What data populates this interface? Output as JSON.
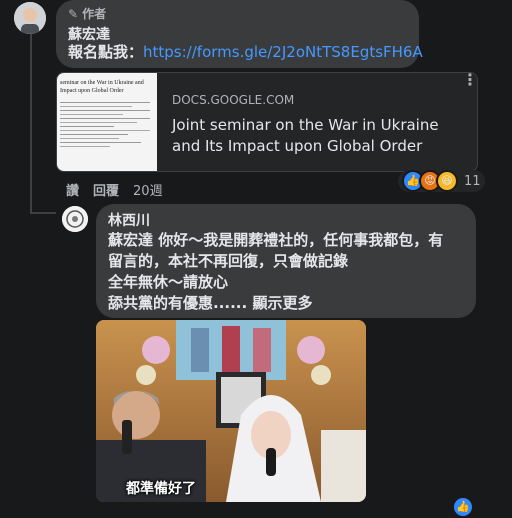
{
  "comment1": {
    "badge": "作者",
    "author": "蘇宏達",
    "text_label": "報名點我：",
    "link": "https://forms.gle/2J2oNtTS8EgtsFH6A"
  },
  "preview": {
    "domain": "DOCS.GOOGLE.COM",
    "title_line1": "Joint seminar on the War in Ukraine",
    "title_line2": "and Its Impact upon Global Order",
    "thumb_line1": "seminar on the War in Ukraine and",
    "thumb_line2": "Impact upon Global Order"
  },
  "actions": {
    "like": "讚",
    "reply": "回覆",
    "time": "20週",
    "reaction_count": "11"
  },
  "comment2": {
    "author": "林西川",
    "line1": "蘇宏達 你好～我是開葬禮社的，任何事我都包，有",
    "line2": "留言的，本社不再回復，只會做記錄",
    "line3": "全年無休～請放心",
    "line4_text": "舔共黨的有優惠......",
    "see_more": "顯示更多"
  },
  "image": {
    "caption": "都準備好了"
  },
  "icons": {
    "more": "more-icon",
    "pencil": "pencil-icon",
    "like": "like-icon"
  }
}
